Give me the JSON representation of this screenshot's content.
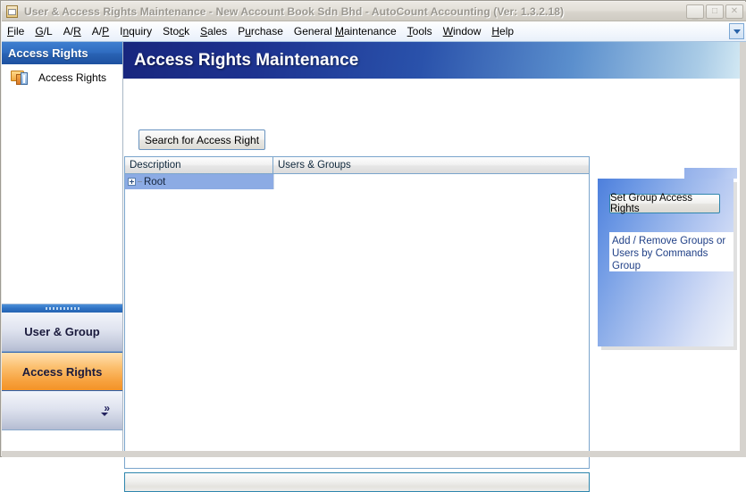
{
  "window": {
    "title": "User & Access Rights Maintenance - New Account Book Sdn Bhd - AutoCount Accounting (Ver: 1.3.2.18)",
    "app_icon": "document-window-icon",
    "buttons": {
      "minimize": "minimize-button",
      "maximize": "maximize-button",
      "close": "close-button",
      "minimize_glyph": "_",
      "maximize_glyph": "□",
      "close_glyph": "✕"
    }
  },
  "menu": {
    "items": [
      {
        "label": "File",
        "accel": "F"
      },
      {
        "label": "G/L",
        "accel": "G"
      },
      {
        "label": "A/R",
        "accel": "R"
      },
      {
        "label": "A/P",
        "accel": "P"
      },
      {
        "label": "Inquiry",
        "accel": "n"
      },
      {
        "label": "Stock",
        "accel": "c"
      },
      {
        "label": "Sales",
        "accel": "S"
      },
      {
        "label": "Purchase",
        "accel": "u"
      },
      {
        "label": "General Maintenance",
        "accel": "M"
      },
      {
        "label": "Tools",
        "accel": "T"
      },
      {
        "label": "Window",
        "accel": "W"
      },
      {
        "label": "Help",
        "accel": "H"
      }
    ],
    "overflow_icon": "chevron-down-icon"
  },
  "sidebar": {
    "header": "Access Rights",
    "entries": [
      {
        "label": "Access Rights",
        "icon": "folder-document-icon"
      }
    ],
    "nav_buttons": [
      {
        "label": "User & Group",
        "active": false
      },
      {
        "label": "Access Rights",
        "active": true
      }
    ],
    "expand_chevron": "»",
    "expand_down_icon": "chevron-down-icon",
    "splitter_icon": "grip-handle-icon"
  },
  "main": {
    "banner_title": "Access Rights Maintenance",
    "search_button": "Search for Access Right",
    "grid": {
      "columns": [
        "Description",
        "Users & Groups"
      ],
      "rows": [
        {
          "description": "Root",
          "users_groups": "",
          "expander": "plus-expander-icon",
          "selected": true
        }
      ]
    },
    "footer_value": ""
  },
  "right_panel": {
    "button_label": "Set Group Access Rights",
    "note": "Add / Remove Groups or Users by Commands Group"
  },
  "colors": {
    "banner_dark": "#18267e",
    "banner_light": "#d8ecf5",
    "accent_orange": "#f7a23f",
    "selection_blue": "#8cabe4",
    "nav_header_blue": "#2a63b4",
    "grid_border": "#7aa5cc",
    "panel_blue": "#4d7fdc",
    "note_text": "#1f3f86"
  }
}
